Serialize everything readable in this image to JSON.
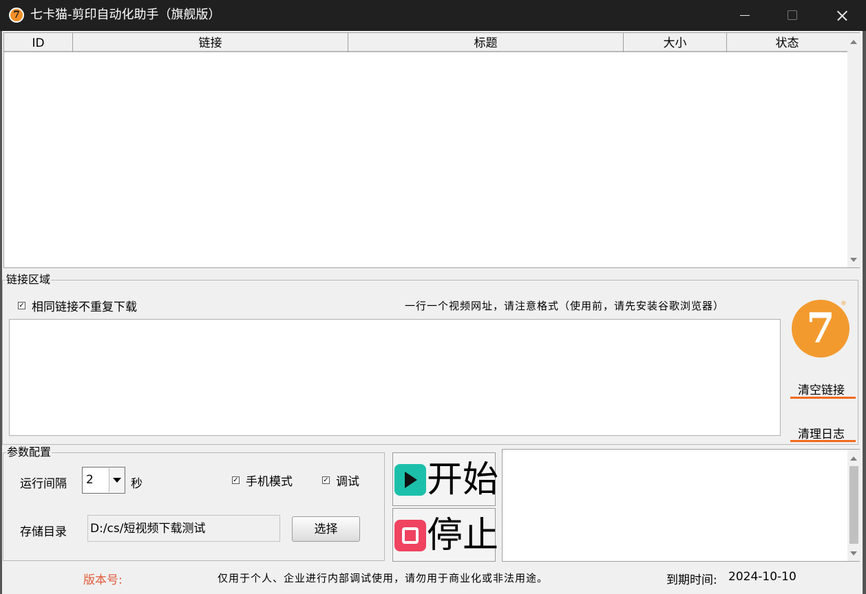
{
  "window": {
    "icon_glyph": "7",
    "title": "七卡猫-剪印自动化助手（旗舰版）",
    "controls": [
      "minimize-icon",
      "maximize-icon",
      "close-icon"
    ]
  },
  "table": {
    "columns": [
      "ID",
      "链接",
      "标题",
      "大小",
      "状态"
    ],
    "rows": []
  },
  "link_area": {
    "group_label": "链接区域",
    "dedupe_label": "相同链接不重复下载",
    "dedupe_checked": true,
    "hint": "一行一个视频网址，请注意格式（使用前，请先安装谷歌浏览器）",
    "textarea_value": "",
    "logo_glyph": "7",
    "logo_registered": "®",
    "clear_links_label": "清空链接",
    "clear_log_label": "清理日志",
    "accent_color": "#f26a1b"
  },
  "params": {
    "group_label": "参数配置",
    "interval_label": "运行间隔",
    "interval_value": "2",
    "interval_unit": "秒",
    "mobile_mode_label": "手机模式",
    "mobile_mode_checked": true,
    "debug_label": "调试",
    "debug_checked": true,
    "dir_label": "存储目录",
    "dir_value": "D:/cs/短视频下载测试",
    "select_label": "选择"
  },
  "actions": {
    "start_label": "开始",
    "start_color": "#1cc0aa",
    "stop_label": "停止",
    "stop_color": "#ef4360"
  },
  "log": {
    "content": ""
  },
  "footer": {
    "version_label": "版本号:",
    "version_color": "#e05a3a",
    "notice": "仅用于个人、企业进行内部调试使用，请勿用于商业化或非法用途。",
    "expiry_label": "到期时间:",
    "expiry_date": "2024-10-10"
  }
}
